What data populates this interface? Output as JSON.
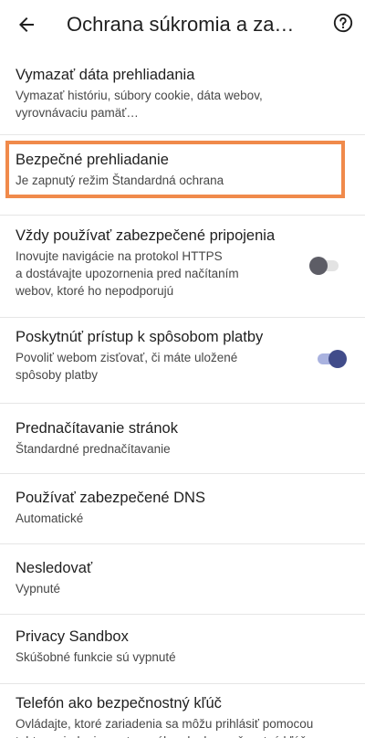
{
  "header": {
    "title": "Ochrana súkromia a za…",
    "back_icon": "arrow-back-icon",
    "help_icon": "help-circle-icon"
  },
  "colors": {
    "highlight_border": "#f08a4b",
    "toggle_on_thumb": "#414c8a",
    "toggle_on_track": "#a9b2df",
    "toggle_off_thumb": "#5d5d66"
  },
  "settings": [
    {
      "title": "Vymazať dáta prehliadania",
      "subtitle": "Vymazať históriu, súbory cookie, dáta webov,\nvyrovnávaciu pamäť…"
    },
    {
      "title": "Bezpečné prehliadanie",
      "subtitle": "Je zapnutý režim Štandardná ochrana"
    },
    {
      "title": "Vždy používať zabezpečené pripojenia",
      "subtitle": "Inovujte navigácie na protokol HTTPS\na dostávajte upozornenia pred načítaním\nwebov, ktoré ho nepodporujú",
      "toggle": "off"
    },
    {
      "title": "Poskytnúť prístup k spôsobom platby",
      "subtitle": "Povoliť webom zisťovať, či máte uložené\nspôsoby platby",
      "toggle": "on"
    },
    {
      "title": "Prednačítavanie stránok",
      "subtitle": "Štandardné prednačítavanie"
    },
    {
      "title": "Používať zabezpečené DNS",
      "subtitle": "Automatické"
    },
    {
      "title": "Nesledovať",
      "subtitle": "Vypnuté"
    },
    {
      "title": "Privacy Sandbox",
      "subtitle": "Skúšobné funkcie sú vypnuté"
    },
    {
      "title": "Telefón ako bezpečnostný kľúč",
      "subtitle": "Ovládajte, ktoré zariadenia sa môžu prihlásiť pomocou\ntohto zariadenia nastaveného ako bezpečnostný kľúč"
    }
  ]
}
